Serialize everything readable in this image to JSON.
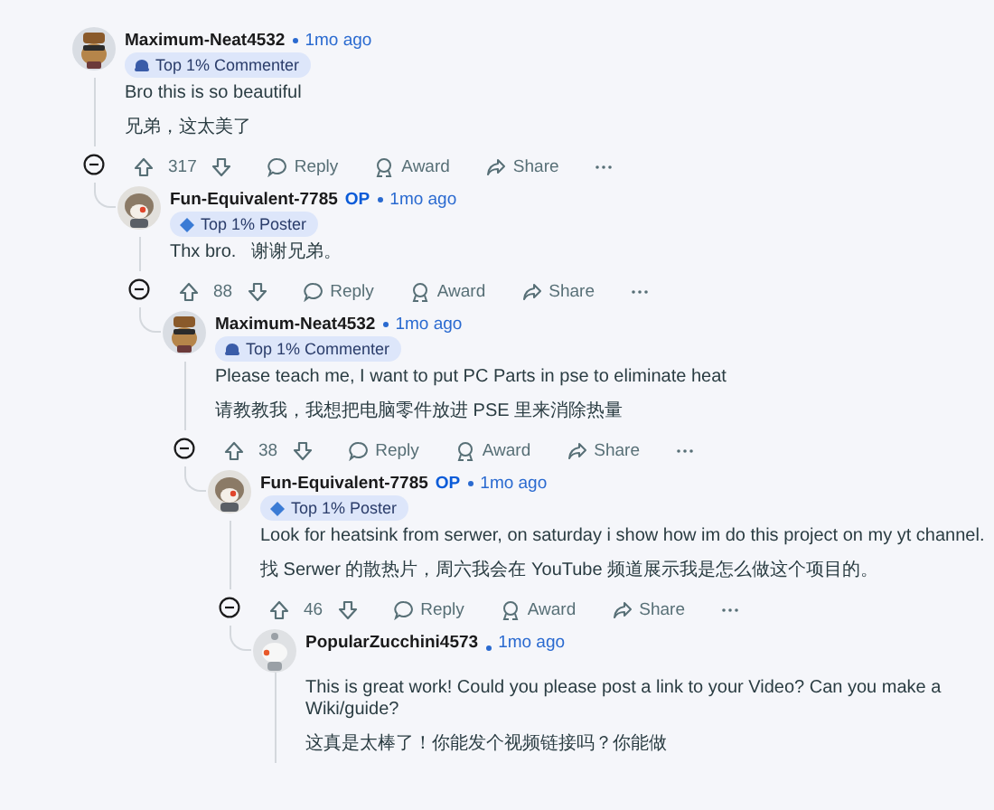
{
  "comments": [
    {
      "author": "Maximum-Neat4532",
      "time": "1mo ago",
      "badge": {
        "kind": "commenter",
        "label": "Top 1% Commenter"
      },
      "paragraphs": [
        "Bro this is so beautiful",
        "兄弟，这太美了"
      ],
      "expanded": true,
      "actions": {
        "score": "317",
        "reply": "Reply",
        "award": "Award",
        "share": "Share"
      },
      "children": [
        {
          "author": "Fun-Equivalent-7785",
          "op": "OP",
          "time": "1mo ago",
          "badge": {
            "kind": "poster",
            "label": "Top 1% Poster"
          },
          "paragraphs": [
            "Thx bro.   谢谢兄弟。"
          ],
          "expanded": true,
          "actions": {
            "score": "88",
            "reply": "Reply",
            "award": "Award",
            "share": "Share"
          },
          "children": [
            {
              "author": "Maximum-Neat4532",
              "time": "1mo ago",
              "badge": {
                "kind": "commenter",
                "label": "Top 1% Commenter"
              },
              "paragraphs": [
                "Please teach me, I want to put PC Parts in pse to eliminate heat",
                "请教教我，我想把电脑零件放进 PSE 里来消除热量"
              ],
              "expanded": true,
              "actions": {
                "score": "38",
                "reply": "Reply",
                "award": "Award",
                "share": "Share"
              },
              "children": [
                {
                  "author": "Fun-Equivalent-7785",
                  "op": "OP",
                  "time": "1mo ago",
                  "badge": {
                    "kind": "poster",
                    "label": "Top 1% Poster"
                  },
                  "paragraphs": [
                    "Look for heatsink from serwer, on saturday i show how im do this project on my yt channel.",
                    "找 Serwer 的散热片，周六我会在 YouTube 频道展示我是怎么做这个项目的。"
                  ],
                  "expanded": true,
                  "actions": {
                    "score": "46",
                    "reply": "Reply",
                    "award": "Award",
                    "share": "Share"
                  },
                  "children": [
                    {
                      "author": "PopularZucchini4573",
                      "time": "1mo ago",
                      "paragraphs": [
                        "This is great work! Could you please post a link to your Video? Can you make a Wiki/guide?",
                        "这真是太棒了！你能发个视频链接吗？你能做"
                      ]
                    }
                  ]
                }
              ]
            }
          ]
        }
      ]
    }
  ]
}
